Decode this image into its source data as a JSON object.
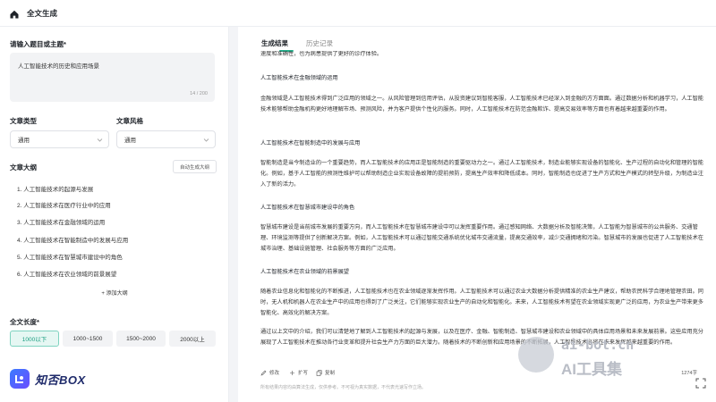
{
  "header": {
    "title": "全文生成"
  },
  "left": {
    "topic_label": "请输入题目或主题*",
    "topic_value": "人工智能技术的历史和应用场景",
    "topic_count": "14 / 200",
    "type_label": "文章类型",
    "type_value": "通用",
    "style_label": "文章风格",
    "style_value": "通用",
    "outline_label": "文章大纲",
    "auto_outline_button": "自动生成大纲",
    "outline_items": [
      "1. 人工智能技术的起源与发展",
      "2. 人工智能技术在医疗行业中的应用",
      "3. 人工智能技术在金融领域的运用",
      "4. 人工智能技术在智能制造中的发展与应用",
      "5. 人工智能技术在智慧城市建设中的角色",
      "6. 人工智能技术在农业领域的前景展望"
    ],
    "add_outline": "+ 添加大纲",
    "length_label": "全文长度*",
    "length_options": [
      "1000以下",
      "1000~1500",
      "1500~2000",
      "2000以上"
    ],
    "length_selected": "1000以下",
    "brand": "知否BOX"
  },
  "right": {
    "tabs": [
      "生成结果",
      "历史记录"
    ],
    "active_tab": "生成结果",
    "paragraphs": [
      "速度和准确性，也为病患提供了更好的诊疗体验。",
      "人工智能技术在金融领域的运用",
      "金融领域是人工智能技术得到广泛应用的领域之一。从风险管理到信用评估，从投资建议到智能客服，人工智能技术已经深入到金融的方方面面。通过数据分析和机器学习，人工智能技术能够帮助金融机构更好地理解市场、预测风险，并为客户提供个性化的服务。同时，人工智能技术在防范金融欺诈、提高交易效率等方面也有着越来越重要的作用。",
      "人工智能技术在智能制造中的发展与应用",
      "智能制造是当今制造业的一个重要趋势，而人工智能技术的应用正是智能制造的重要驱动力之一。通过人工智能技术，制造业能够实现设备的智能化、生产过程的自动化和管理的智能化。例如，基于人工智能的预测性维护可以帮助制造企业实现设备故障的提前预防，提高生产效率和降低成本。同时，智能制造也促进了生产方式和生产模式的转型升级，为制造业注入了新的活力。",
      "人工智能技术在智慧城市建设中的角色",
      "智慧城市建设是当前城市发展的重要方向，而人工智能技术在智慧城市建设中可以发挥重要作用。通过感知网络、大数据分析及智能决策，人工智能为智慧城市的公共服务、交通管理、环境监测等提供了创新解决方案。例如，人工智能技术可以通过智能交通系统优化城市交通流量，提高交通效率，减少交通拥堵和污染。智慧城市的发展也促进了人工智能技术在城市治理、基础设施管理、社会服务等方面的广泛应用。",
      "人工智能技术在农业领域的前景展望",
      "随着农业信息化和智能化的不断推进，人工智能技术也在农业领域逐渐发挥作用。人工智能技术可以通过农业大数据分析提供精准的农业生产建议，帮助农民科学合理地管理农田。同时，无人机和机器人在农业生产中的应用也得到了广泛关注，它们能够实现农业生产的自动化和智能化。未来，人工智能技术有望在农业领域实现更广泛的应用，为农业生产带来更多智能化、高效化的解决方案。",
      "通过以上文中的介绍，我们可以清楚地了解到人工智能技术的起源与发展，以及在医疗、金融、智能制造、智慧城市建设和农业领域中的具体应用场景和未来发展前景。这些应用充分展现了人工智能技术在推动各行业变革和提升社会生产力方面的巨大潜力。随着技术的不断创新和应用场景的不断拓展，人工智能技术必将在未来发挥越来越重要的作用。"
    ],
    "actions": [
      "修改",
      "扩写",
      "复制"
    ],
    "word_count": "1274字",
    "disclaimer": "所有结果内容均由算法生成，仅供参考。不可视为真实数据，不代表光速写作立场。"
  },
  "watermark": {
    "line1": "ai-bot.cn",
    "line2": "AI工具集"
  },
  "colors": {
    "accent": "#23b08c",
    "active_bg": "#e6f7f3"
  }
}
